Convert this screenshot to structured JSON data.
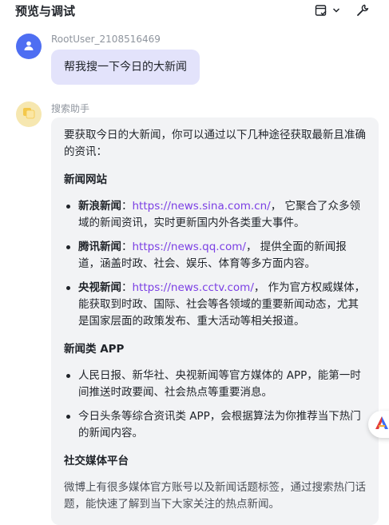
{
  "header": {
    "title": "预览与调试"
  },
  "messages": {
    "user": {
      "name": "RootUser_2108516469",
      "text": "帮我搜一下今日的大新闻"
    },
    "bot": {
      "name": "搜索助手",
      "intro": "要获取今日的大新闻，你可以通过以下几种途径获取最新且准确的资讯：",
      "sections": [
        {
          "title": "新闻网站",
          "items": [
            {
              "label": "新浪新闻",
              "sep": "：",
              "url": "https://news.sina.com.cn/",
              "desc": "， 它聚合了众多领域的新闻资讯，实时更新国内外各类重大事件。"
            },
            {
              "label": "腾讯新闻",
              "sep": "：",
              "url": "https://news.qq.com/",
              "desc": "， 提供全面的新闻报道，涵盖时政、社会、娱乐、体育等多方面内容。"
            },
            {
              "label": "央视新闻",
              "sep": "：",
              "url": "https://news.cctv.com/",
              "desc": "， 作为官方权威媒体，能获取到时政、国际、社会等各领域的重要新闻动态，尤其是国家层面的政策发布、重大活动等相关报道。"
            }
          ]
        },
        {
          "title": "新闻类 APP",
          "items": [
            {
              "text": "人民日报、新华社、央视新闻等官方媒体的 APP，能第一时间推送时政要闻、社会热点等重要消息。"
            },
            {
              "text": "今日头条等综合资讯类 APP，会根据算法为你推荐当下热门的新闻内容。"
            }
          ]
        },
        {
          "title": "社交媒体平台",
          "paragraph": "微博上有很多媒体官方账号以及新闻话题标签，通过搜索热门话题，能快速了解到当下大家关注的热点新闻。"
        }
      ]
    }
  },
  "icons": {
    "debug_panel": "panel-check-icon",
    "dropdown": "chevron-down-icon",
    "tools": "wrench-icon",
    "user_avatar": "user-icon",
    "bot_avatar": "cards-icon",
    "float": "brand-a-icon"
  },
  "colors": {
    "link": "#7b3fe4",
    "user_bubble": "#e3e3fb",
    "bot_bubble": "#f2f3f5",
    "user_avatar": "#4e6ef2"
  }
}
